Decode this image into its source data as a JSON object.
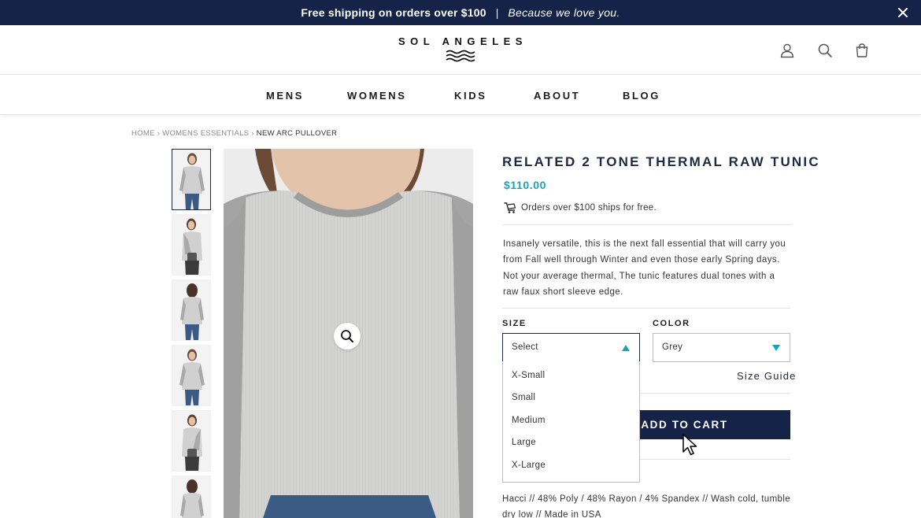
{
  "promo": {
    "bold": "Free shipping on orders over $100",
    "separator": "|",
    "tagline": "Because we love you."
  },
  "brand": {
    "name": "SOL ANGELES"
  },
  "icons": {
    "close": "close-icon",
    "account": "user-icon",
    "search": "search-icon",
    "cart": "shopping-bag-icon",
    "shipping": "shipping-cart-icon",
    "zoom": "zoom-icon"
  },
  "nav": [
    "MENS",
    "WOMENS",
    "KIDS",
    "ABOUT",
    "BLOG"
  ],
  "breadcrumb": {
    "home": "HOME",
    "sep": "›",
    "category": "WOMENS ESSENTIALS",
    "current": "NEW ARC PULLOVER"
  },
  "product": {
    "title": "RELATED 2 TONE THERMAL RAW TUNIC",
    "price": "$110.00",
    "shipping_note": "Orders over $100 ships for free.",
    "description": "Insanely versatile, this is the next fall essential that will carry you from Fall well through Winter and even those early Spring days. Not your average thermal, The tunic features dual tones with a raw faux short sleeve edge.",
    "details": "Hacci // 48% Poly / 48% Rayon / 4% Spandex // Wash cold, tumble dry low // Made in USA"
  },
  "options": {
    "size_label": "SIZE",
    "size_value": "Select",
    "size_options": [
      "X-Small",
      "Small",
      "Medium",
      "Large",
      "X-Large"
    ],
    "color_label": "COLOR",
    "color_value": "Grey",
    "size_guide": "Size Guide"
  },
  "actions": {
    "add_to_cart": "ADD TO CART"
  },
  "colors": {
    "navy": "#142347",
    "accent": "#1aa3b8",
    "text": "#333333"
  }
}
